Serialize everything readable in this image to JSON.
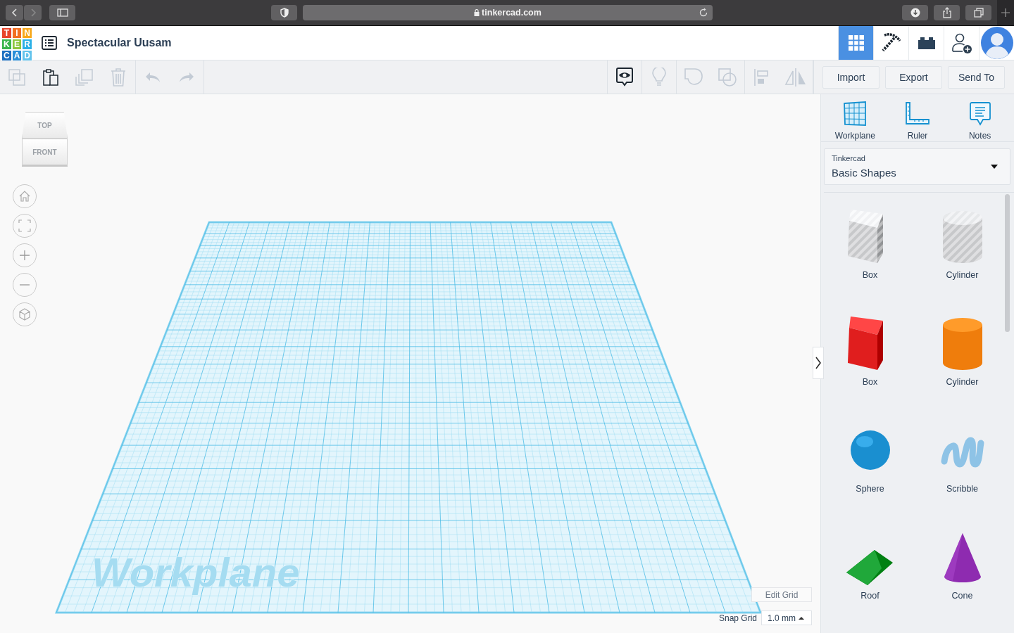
{
  "browser": {
    "url": "tinkercad.com"
  },
  "header": {
    "logo": [
      {
        "letter": "T",
        "color": "#e8452c"
      },
      {
        "letter": "I",
        "color": "#f26f21"
      },
      {
        "letter": "N",
        "color": "#f7a81b"
      },
      {
        "letter": "K",
        "color": "#39b54a"
      },
      {
        "letter": "E",
        "color": "#8dc63f"
      },
      {
        "letter": "R",
        "color": "#2bb0e6"
      },
      {
        "letter": "C",
        "color": "#1c6fc0"
      },
      {
        "letter": "A",
        "color": "#2a8fd8"
      },
      {
        "letter": "D",
        "color": "#62c3ec"
      }
    ],
    "title": "Spectacular Uusam",
    "views": [
      {
        "kind": "grid",
        "selected": true
      },
      {
        "kind": "pickaxe",
        "selected": false
      },
      {
        "kind": "bricks",
        "selected": false
      },
      {
        "kind": "user-add",
        "selected": false
      },
      {
        "kind": "avatar",
        "selected": false
      }
    ]
  },
  "toolbar": {
    "edit_tools": [
      {
        "kind": "copy",
        "disabled": true
      },
      {
        "kind": "paste",
        "disabled": false
      },
      {
        "kind": "duplicate",
        "disabled": true
      },
      {
        "kind": "delete",
        "disabled": true
      }
    ],
    "history": [
      {
        "kind": "undo",
        "disabled": true
      },
      {
        "kind": "redo",
        "disabled": true
      }
    ],
    "shape_tools": [
      {
        "kind": "notes-toggle",
        "disabled": false
      },
      {
        "kind": "light",
        "disabled": true
      },
      {
        "kind": "group",
        "disabled": true
      },
      {
        "kind": "ungroup",
        "disabled": true
      },
      {
        "kind": "align",
        "disabled": true
      },
      {
        "kind": "mirror",
        "disabled": true
      }
    ],
    "buttons": [
      "Import",
      "Export",
      "Send To"
    ]
  },
  "view_cube": {
    "top": "TOP",
    "front": "FRONT"
  },
  "workplane": {
    "label": "Workplane"
  },
  "grid_controls": {
    "edit_button": "Edit Grid",
    "snap_label": "Snap Grid",
    "snap_value": "1.0 mm"
  },
  "panel": {
    "tools": [
      {
        "kind": "workplane",
        "label": "Workplane"
      },
      {
        "kind": "ruler",
        "label": "Ruler"
      },
      {
        "kind": "notes",
        "label": "Notes"
      }
    ],
    "library": {
      "source": "Tinkercad",
      "category": "Basic Shapes"
    },
    "shapes": [
      {
        "kind": "box",
        "hole": true,
        "color": "#b9bfc9",
        "label": "Box"
      },
      {
        "kind": "cylinder",
        "hole": true,
        "color": "#b9bfc9",
        "label": "Cylinder"
      },
      {
        "kind": "box",
        "hole": false,
        "color": "#e01e1e",
        "label": "Box"
      },
      {
        "kind": "cylinder",
        "hole": false,
        "color": "#ef7d0c",
        "label": "Cylinder"
      },
      {
        "kind": "sphere",
        "hole": false,
        "color": "#1a8fd0",
        "label": "Sphere"
      },
      {
        "kind": "scribble",
        "hole": false,
        "color": "#8ec3e6",
        "label": "Scribble"
      },
      {
        "kind": "roof",
        "hole": false,
        "color": "#20a83a",
        "label": "Roof"
      },
      {
        "kind": "cone",
        "hole": false,
        "color": "#8e2bb0",
        "label": "Cone"
      }
    ]
  }
}
